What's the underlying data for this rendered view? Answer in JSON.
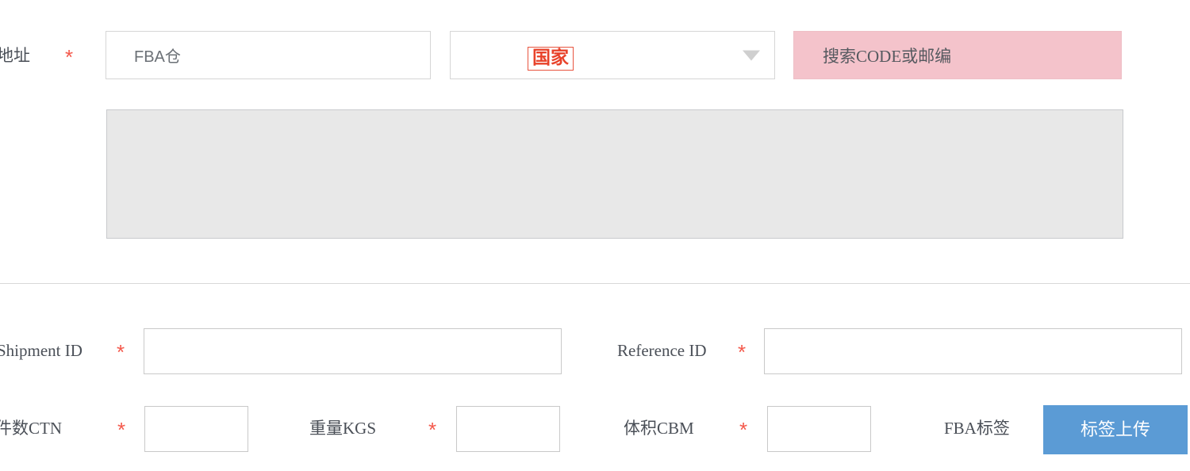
{
  "form": {
    "address_row": {
      "label": "地址",
      "required_mark": "*",
      "warehouse": {
        "value": "FBA仓",
        "placeholder": "FBA仓"
      },
      "country": {
        "value": "国家",
        "caret_icon": "chevron-down-icon",
        "highlight_color": "#e8422a"
      },
      "code_search": {
        "value": "搜索CODE或邮编",
        "background_color": "#f4c3cb"
      },
      "address_detail": {
        "value": "",
        "placeholder": "",
        "background_color": "#e8e8e8",
        "disabled": true
      }
    },
    "shipment_row": {
      "shipment_id": {
        "label": "Shipment ID",
        "required_mark": "*",
        "value": "",
        "placeholder": ""
      },
      "reference_id": {
        "label": "Reference ID",
        "required_mark": "*",
        "value": "",
        "placeholder": ""
      }
    },
    "measure_row": {
      "ctn": {
        "label": "件数CTN",
        "required_mark": "*",
        "value": "",
        "placeholder": ""
      },
      "kgs": {
        "label": "重量KGS",
        "required_mark": "*",
        "value": "",
        "placeholder": ""
      },
      "cbm": {
        "label": "体积CBM",
        "required_mark": "*",
        "value": "",
        "placeholder": ""
      },
      "fba_label": {
        "label": "FBA标签",
        "upload_button": "标签上传",
        "button_color": "#5b9bd5"
      }
    }
  }
}
